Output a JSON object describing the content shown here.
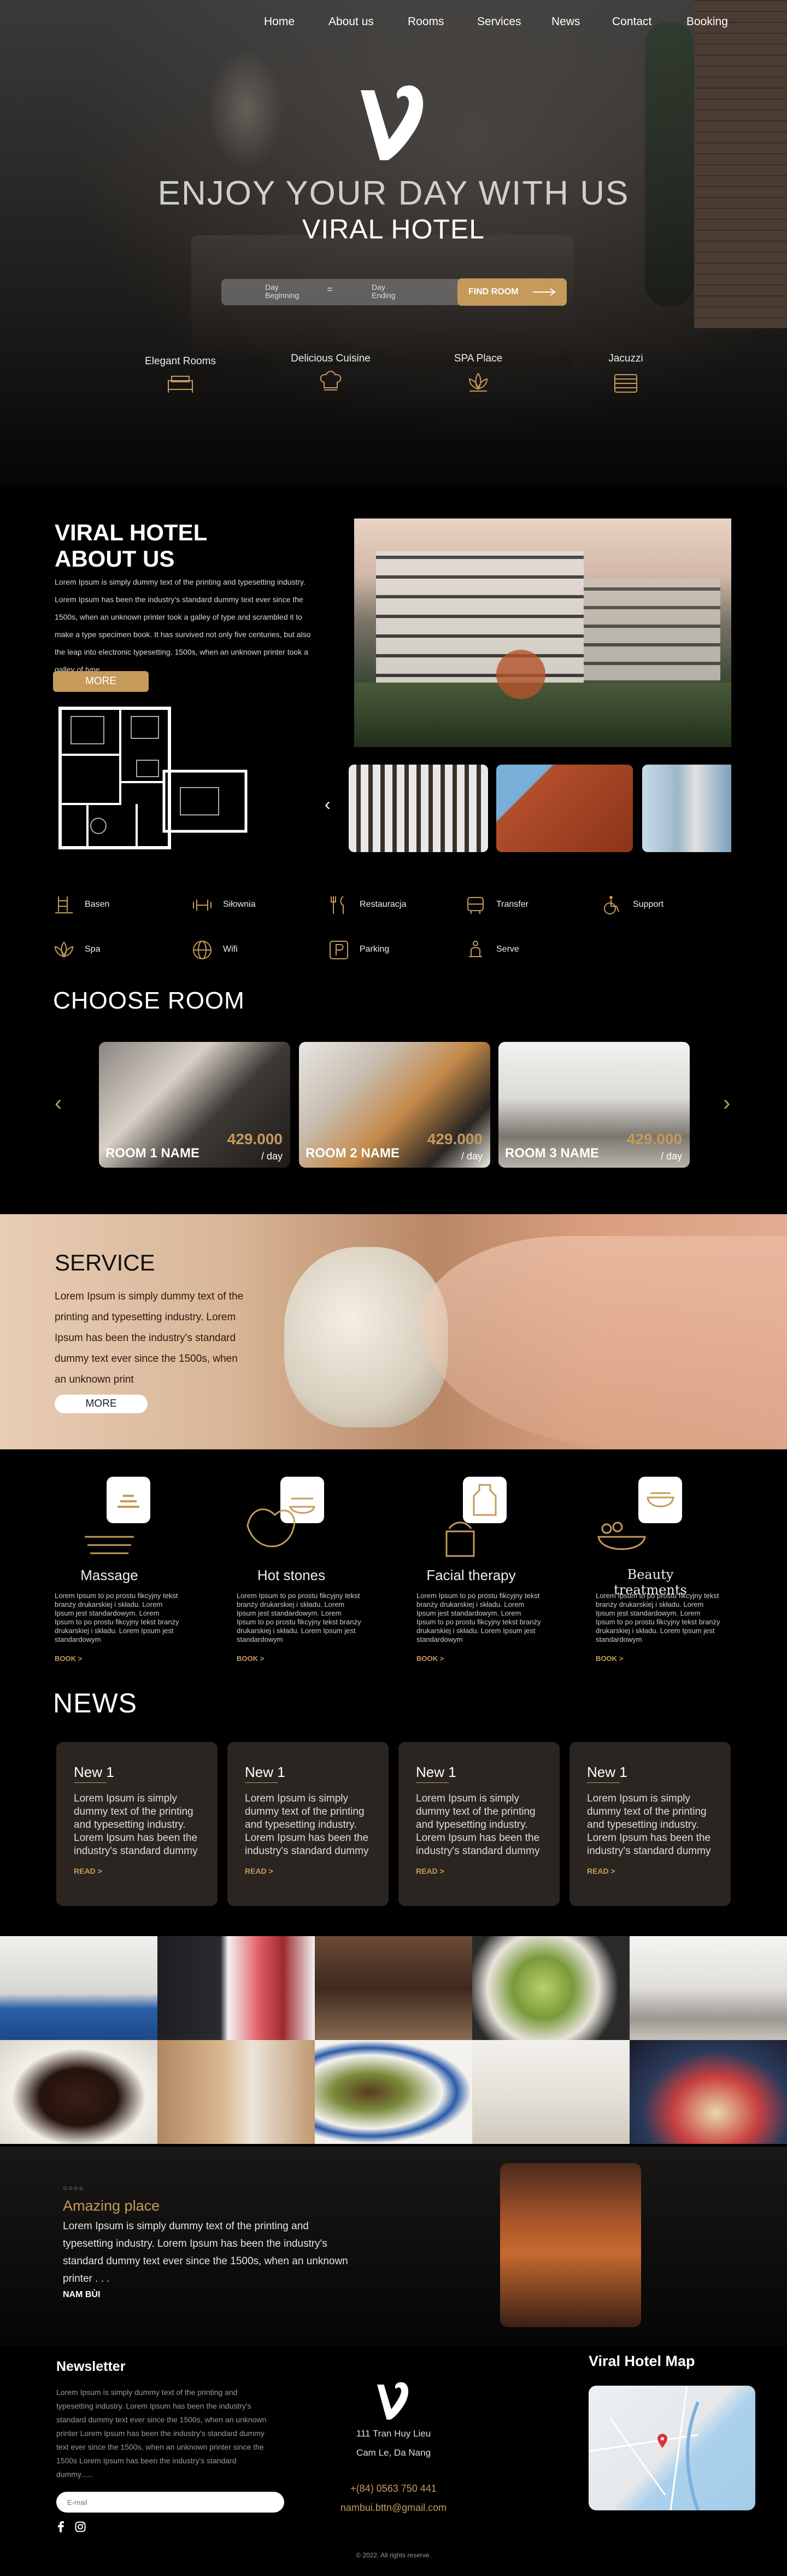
{
  "nav": {
    "items": [
      "Home",
      "About us",
      "Rooms",
      "Services",
      "News",
      "Contact",
      "Booking"
    ]
  },
  "hero": {
    "title1": "ENJOY YOUR DAY WITH US",
    "title2": "VIRAL HOTEL",
    "day_begin": "Day Beginning",
    "separator": "=",
    "day_end": "Day Ending",
    "find_button": "FIND ROOM",
    "features": [
      "Elegant Rooms",
      "Delicious Cuisine",
      "SPA Place",
      "Jacuzzi"
    ]
  },
  "about": {
    "title_line1": "VIRAL HOTEL",
    "title_line2": "ABOUT US",
    "text": "Lorem Ipsum is simply dummy text of the printing and typesetting industry. Lorem Ipsum has been the industry's standard dummy text ever since the 1500s, when an unknown printer took a galley of type and scrambled it to make a type specimen book. It has survived not only five centuries, but also the leap into electronic typesetting. 1500s, when an unknown printer took a galley of type",
    "more": "MORE",
    "prev_arrow": "‹"
  },
  "amenities": [
    "Basen",
    "Siłownia",
    "Restauracja",
    "Transfer",
    "Support",
    "Spa",
    "Wifi",
    "Parking",
    "Serve"
  ],
  "rooms": {
    "title": "CHOOSE ROOM",
    "items": [
      {
        "name": "ROOM 1 NAME",
        "price": "429.000",
        "per": "/ day"
      },
      {
        "name": "ROOM 2 NAME",
        "price": "429.000",
        "per": "/ day"
      },
      {
        "name": "ROOM 3 NAME",
        "price": "429.000",
        "per": "/ day"
      }
    ],
    "left_arrow": "‹",
    "right_arrow": "›"
  },
  "service": {
    "title": "SERVICE",
    "text": "Lorem Ipsum is simply dummy text of the printing and typesetting industry. Lorem Ipsum has been the industry's standard dummy text ever since the 1500s, when an unknown print",
    "more": "MORE"
  },
  "spa": [
    {
      "title": "Massage",
      "text": "Lorem Ipsum to po prostu fikcyjny tekst branży drukarskiej i składu. Lorem Ipsum jest standardowym. Lorem Ipsum to po prostu fikcyjny tekst branży drukarskiej i składu. Lorem Ipsum jest standardowym",
      "book": "BOOK >"
    },
    {
      "title": "Hot stones",
      "text": "Lorem Ipsum to po prostu fikcyjny tekst branży drukarskiej i składu. Lorem Ipsum jest standardowym. Lorem Ipsum to po prostu fikcyjny tekst branży drukarskiej i składu. Lorem Ipsum jest standardowym",
      "book": "BOOK >"
    },
    {
      "title": "Facial therapy",
      "text": "Lorem Ipsum to po prostu fikcyjny tekst branży drukarskiej i składu. Lorem Ipsum jest standardowym. Lorem Ipsum to po prostu fikcyjny tekst branży drukarskiej i składu. Lorem Ipsum jest standardowym",
      "book": "BOOK >"
    },
    {
      "title": "Beauty treatments",
      "text": "Lorem Ipsum to po prostu fikcyjny tekst branży drukarskiej i składu. Lorem Ipsum jest standardowym. Lorem Ipsum to po prostu fikcyjny tekst branży drukarskiej i składu. Lorem Ipsum jest standardowym",
      "book": "BOOK >"
    }
  ],
  "news": {
    "title": "NEWS",
    "items": [
      {
        "heading": "New 1",
        "text": "Lorem Ipsum is simply dummy text of the printing and typesetting industry. Lorem Ipsum has been the industry's standard dummy",
        "read": "READ >"
      },
      {
        "heading": "New 1",
        "text": "Lorem Ipsum is simply dummy text of the printing and typesetting industry. Lorem Ipsum has been the industry's standard dummy",
        "read": "READ >"
      },
      {
        "heading": "New 1",
        "text": "Lorem Ipsum is simply dummy text of the printing and typesetting industry. Lorem Ipsum has been the industry's standard dummy",
        "read": "READ >"
      },
      {
        "heading": "New 1",
        "text": "Lorem Ipsum is simply dummy text of the printing and typesetting industry. Lorem Ipsum has been the industry's standard dummy",
        "read": "READ >"
      }
    ]
  },
  "testimonial": {
    "dots": "○○○○",
    "title": "Amazing place",
    "text": "Lorem Ipsum is simply dummy text of the printing and typesetting industry. Lorem Ipsum has been the industry's standard dummy text ever since the 1500s, when an unknown printer . . .",
    "author": "NAM BÙI"
  },
  "footer": {
    "newsletter_title": "Newsletter",
    "newsletter_text": "Lorem Ipsum is simply dummy text of the printing and typesetting industry. Lorem Ipsum has been the industry's standard dummy text ever since the 1500s, when an unknown printer Lorem Ipsum has been the industry's standard dummy text ever since the 1500s, when an unknown printer since the 1500s Lorem Ipsum has been the industry's standard dummy......",
    "email_placeholder": "E-mail",
    "address1": "111 Tran Huy Lieu",
    "address2": "Cam Le, Da Nang",
    "phone": "+(84) 0563 750 441",
    "email": "nambui.bttn@gmail.com",
    "map_title": "Viral Hotel Map",
    "copyright": "© 2022. All rights reserve."
  },
  "colors": {
    "accent": "#c69a5b",
    "bg": "#000000",
    "card": "#2a2520"
  }
}
